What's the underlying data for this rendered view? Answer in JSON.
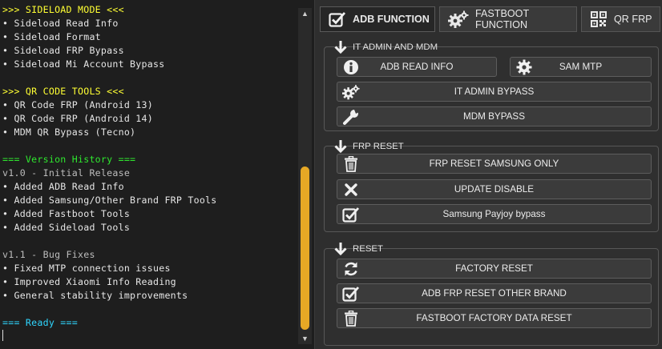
{
  "log": {
    "lines": [
      {
        "text": ">>> SIDELOAD MODE <<<",
        "color": "yellow"
      },
      {
        "text": "• Sideload Read Info",
        "color": "white"
      },
      {
        "text": "• Sideload Format",
        "color": "white"
      },
      {
        "text": "• Sideload FRP Bypass",
        "color": "white"
      },
      {
        "text": "• Sideload Mi Account Bypass",
        "color": "white"
      },
      {
        "text": "",
        "color": "white"
      },
      {
        "text": ">>> QR CODE TOOLS <<<",
        "color": "yellow"
      },
      {
        "text": "• QR Code FRP (Android 13)",
        "color": "white"
      },
      {
        "text": "• QR Code FRP (Android 14)",
        "color": "white"
      },
      {
        "text": "• MDM QR Bypass (Tecno)",
        "color": "white"
      },
      {
        "text": "",
        "color": "white"
      },
      {
        "text": "=== Version History ===",
        "color": "green"
      },
      {
        "text": "v1.0 - Initial Release",
        "color": "grey"
      },
      {
        "text": "• Added ADB Read Info",
        "color": "white"
      },
      {
        "text": "• Added Samsung/Other Brand FRP Tools",
        "color": "white"
      },
      {
        "text": "• Added Fastboot Tools",
        "color": "white"
      },
      {
        "text": "• Added Sideload Tools",
        "color": "white"
      },
      {
        "text": "",
        "color": "white"
      },
      {
        "text": "v1.1 - Bug Fixes",
        "color": "grey"
      },
      {
        "text": "• Fixed MTP connection issues",
        "color": "white"
      },
      {
        "text": "• Improved Xiaomi Info Reading",
        "color": "white"
      },
      {
        "text": "• General stability improvements",
        "color": "white"
      },
      {
        "text": "",
        "color": "white"
      },
      {
        "text": "=== Ready ===",
        "color": "cyan"
      }
    ],
    "scroll": {
      "up_arrow": "▲",
      "down_arrow": "▼"
    }
  },
  "tabs": [
    {
      "label": "ADB FUNCTION",
      "icon": "checkbox-icon",
      "active": true
    },
    {
      "label": "FASTBOOT FUNCTION",
      "icon": "gears-icon",
      "active": false
    },
    {
      "label": "QR FRP",
      "icon": "qr-code-icon",
      "active": false
    }
  ],
  "sections": {
    "it_admin": {
      "title": "IT ADMIN AND MDM",
      "icon": "arrow-down-icon",
      "buttons": {
        "adb_read_info": {
          "label": "ADB READ INFO",
          "icon": "info-icon"
        },
        "sam_mtp": {
          "label": "SAM MTP",
          "icon": "gear-icon"
        },
        "it_admin_bypass": {
          "label": "IT ADMIN BYPASS",
          "icon": "gears-icon"
        },
        "mdm_bypass": {
          "label": "MDM BYPASS",
          "icon": "wrench-icon"
        }
      }
    },
    "frp_reset": {
      "title": "FRP RESET",
      "icon": "arrow-down-icon",
      "buttons": {
        "frp_samsung": {
          "label": "FRP RESET SAMSUNG ONLY",
          "icon": "trash-icon"
        },
        "update_disable": {
          "label": "UPDATE DISABLE",
          "icon": "close-icon"
        },
        "payjoy": {
          "label": "Samsung Payjoy bypass",
          "icon": "checkbox-icon"
        }
      }
    },
    "reset": {
      "title": "RESET",
      "icon": "arrow-down-icon",
      "buttons": {
        "factory_reset": {
          "label": "FACTORY RESET",
          "icon": "refresh-icon"
        },
        "adb_frp_other": {
          "label": "ADB FRP RESET OTHER BRAND",
          "icon": "checkbox-icon"
        },
        "fastboot_factory": {
          "label": "FASTBOOT FACTORY DATA RESET",
          "icon": "trash-icon"
        }
      }
    }
  },
  "colors": {
    "console_bg": "#1e1e1e",
    "panel_bg": "#2e2e2e",
    "scroll_thumb": "#e6a825",
    "heading_yellow": "#ffff33",
    "heading_green": "#2ee82e",
    "heading_cyan": "#2fd6ff"
  }
}
